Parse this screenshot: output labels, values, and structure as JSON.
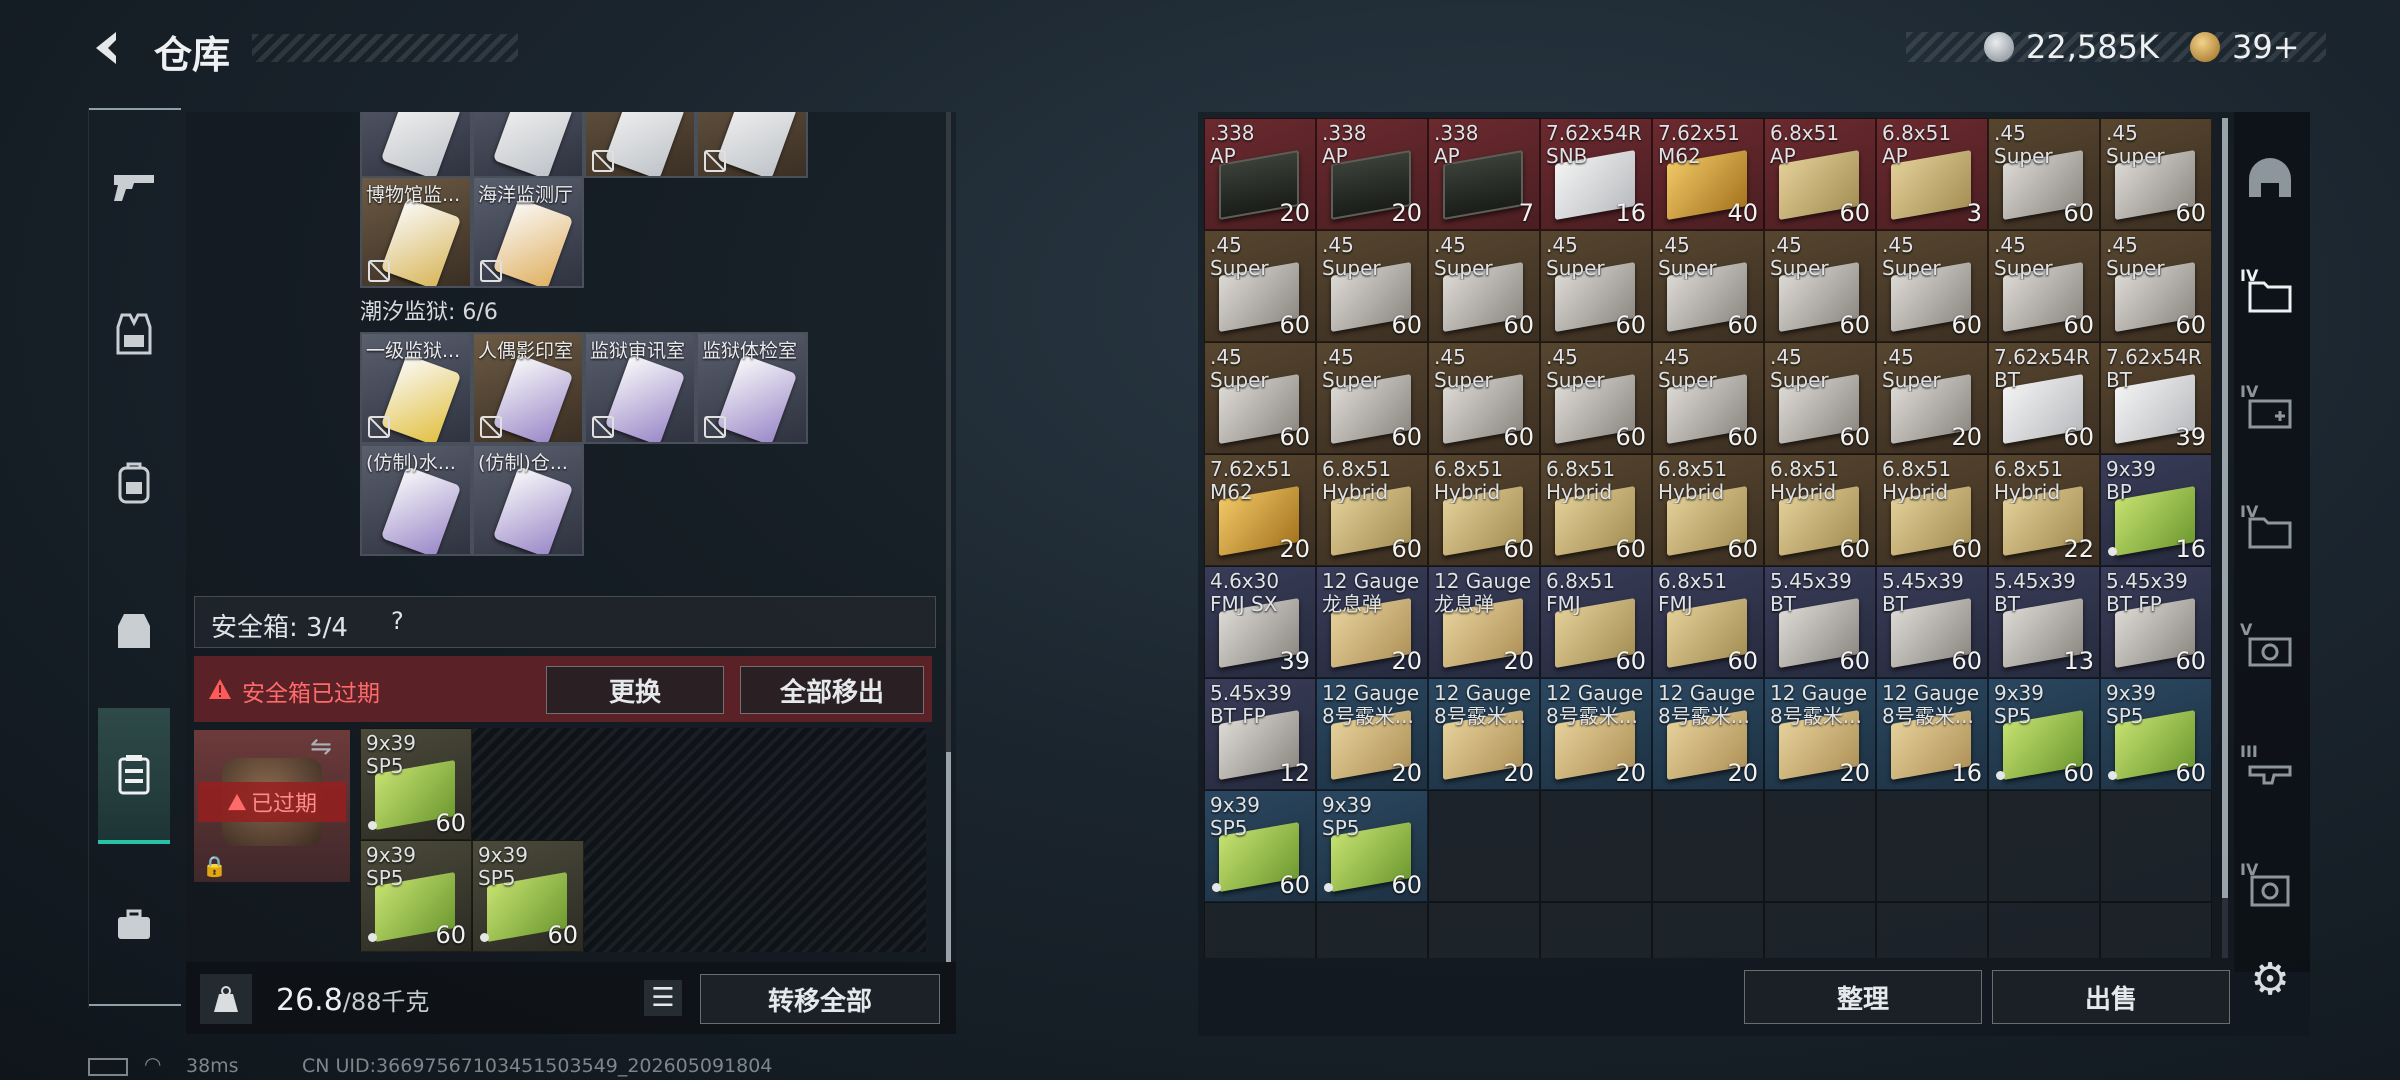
{
  "header": {
    "title": "仓库",
    "currency1": "22,585K",
    "currency2": "39+"
  },
  "left_nav": {
    "icons": [
      "pistol-icon",
      "vest-icon",
      "backpack-icon",
      "rig-icon",
      "case-icon",
      "toolbox-icon"
    ]
  },
  "keys": {
    "top_row_partial": [
      {
        "label": ""
      },
      {
        "label": ""
      },
      {
        "label": ""
      },
      {
        "label": ""
      }
    ],
    "row2": [
      {
        "label": "博物馆监..."
      },
      {
        "label": "海洋监测厅"
      }
    ],
    "section_label": "潮汐监狱: 6/6",
    "row3": [
      {
        "label": "一级监狱..."
      },
      {
        "label": "人偶影印室"
      },
      {
        "label": "监狱审讯室"
      },
      {
        "label": "监狱体检室"
      }
    ],
    "row4": [
      {
        "label": "(仿制)水..."
      },
      {
        "label": "(仿制)仓..."
      }
    ]
  },
  "safebox": {
    "label": "安全箱: 3/4",
    "help": "?",
    "expired_warning": "安全箱已过期",
    "replace_button": "更换",
    "move_all_out_button": "全部移出",
    "expired_badge": "已过期",
    "items": [
      {
        "cal": "9x39\nSP5",
        "count": "60",
        "color": "green"
      },
      {
        "cal": "9x39\nSP5",
        "count": "60",
        "color": "green"
      },
      {
        "cal": "9x39\nSP5",
        "count": "60",
        "color": "green"
      }
    ]
  },
  "footer_left": {
    "weight": "26.8",
    "weight_max": "/88千克",
    "transfer_all_button": "转移全部"
  },
  "footer_right": {
    "organize_button": "整理",
    "sell_button": "出售"
  },
  "status_bar": {
    "ping": "38ms",
    "uid": "CN UID:36697567103451503549_202605091804"
  },
  "colors": {
    "red_bg": "#5a2126",
    "brown_bg": "#4a3a2a",
    "navy_bg": "#2d3148",
    "blue_bg": "#243b4e",
    "accent": "#27c3a6"
  },
  "stash": [
    {
      "cal": ".338\nAP",
      "count": "20",
      "bg": "red",
      "art": "dark"
    },
    {
      "cal": ".338\nAP",
      "count": "20",
      "bg": "red",
      "art": "dark"
    },
    {
      "cal": ".338\nAP",
      "count": "7",
      "bg": "red",
      "art": "dark"
    },
    {
      "cal": "7.62x54R\nSNB",
      "count": "16",
      "bg": "red",
      "art": "white"
    },
    {
      "cal": "7.62x51\nM62",
      "count": "40",
      "bg": "red",
      "art": "gold"
    },
    {
      "cal": "6.8x51\nAP",
      "count": "60",
      "bg": "red",
      "art": "beige"
    },
    {
      "cal": "6.8x51\nAP",
      "count": "3",
      "bg": "red",
      "art": "beige"
    },
    {
      "cal": ".45\nSuper",
      "count": "60",
      "bg": "brown",
      "art": "grey"
    },
    {
      "cal": ".45\nSuper",
      "count": "60",
      "bg": "brown",
      "art": "grey"
    },
    {
      "cal": ".45\nSuper",
      "count": "60",
      "bg": "brown",
      "art": "grey"
    },
    {
      "cal": ".45\nSuper",
      "count": "60",
      "bg": "brown",
      "art": "grey"
    },
    {
      "cal": ".45\nSuper",
      "count": "60",
      "bg": "brown",
      "art": "grey"
    },
    {
      "cal": ".45\nSuper",
      "count": "60",
      "bg": "brown",
      "art": "grey"
    },
    {
      "cal": ".45\nSuper",
      "count": "60",
      "bg": "brown",
      "art": "grey"
    },
    {
      "cal": ".45\nSuper",
      "count": "60",
      "bg": "brown",
      "art": "grey"
    },
    {
      "cal": ".45\nSuper",
      "count": "60",
      "bg": "brown",
      "art": "grey"
    },
    {
      "cal": ".45\nSuper",
      "count": "60",
      "bg": "brown",
      "art": "grey"
    },
    {
      "cal": ".45\nSuper",
      "count": "60",
      "bg": "brown",
      "art": "grey"
    },
    {
      "cal": ".45\nSuper",
      "count": "60",
      "bg": "brown",
      "art": "grey"
    },
    {
      "cal": ".45\nSuper",
      "count": "60",
      "bg": "brown",
      "art": "grey"
    },
    {
      "cal": ".45\nSuper",
      "count": "60",
      "bg": "brown",
      "art": "grey"
    },
    {
      "cal": ".45\nSuper",
      "count": "60",
      "bg": "brown",
      "art": "grey"
    },
    {
      "cal": ".45\nSuper",
      "count": "60",
      "bg": "brown",
      "art": "grey"
    },
    {
      "cal": ".45\nSuper",
      "count": "60",
      "bg": "brown",
      "art": "grey"
    },
    {
      "cal": ".45\nSuper",
      "count": "20",
      "bg": "brown",
      "art": "grey"
    },
    {
      "cal": "7.62x54R\nBT",
      "count": "60",
      "bg": "brown",
      "art": "white"
    },
    {
      "cal": "7.62x54R\nBT",
      "count": "39",
      "bg": "brown",
      "art": "white"
    },
    {
      "cal": "7.62x51\nM62",
      "count": "20",
      "bg": "brown",
      "art": "gold"
    },
    {
      "cal": "6.8x51\nHybrid",
      "count": "60",
      "bg": "brown",
      "art": "beige"
    },
    {
      "cal": "6.8x51\nHybrid",
      "count": "60",
      "bg": "brown",
      "art": "beige"
    },
    {
      "cal": "6.8x51\nHybrid",
      "count": "60",
      "bg": "brown",
      "art": "beige"
    },
    {
      "cal": "6.8x51\nHybrid",
      "count": "60",
      "bg": "brown",
      "art": "beige"
    },
    {
      "cal": "6.8x51\nHybrid",
      "count": "60",
      "bg": "brown",
      "art": "beige"
    },
    {
      "cal": "6.8x51\nHybrid",
      "count": "60",
      "bg": "brown",
      "art": "beige"
    },
    {
      "cal": "6.8x51\nHybrid",
      "count": "22",
      "bg": "brown",
      "art": "beige"
    },
    {
      "cal": "9x39\nBP",
      "count": "16",
      "bg": "navy",
      "art": "green",
      "dot": true
    },
    {
      "cal": "4.6x30\nFMJ SX",
      "count": "39",
      "bg": "navy",
      "art": "grey"
    },
    {
      "cal": "12 Gauge\n龙息弹",
      "count": "20",
      "bg": "navy",
      "art": "tan"
    },
    {
      "cal": "12 Gauge\n龙息弹",
      "count": "20",
      "bg": "navy",
      "art": "tan"
    },
    {
      "cal": "6.8x51\nFMJ",
      "count": "60",
      "bg": "navy",
      "art": "beige"
    },
    {
      "cal": "6.8x51\nFMJ",
      "count": "60",
      "bg": "navy",
      "art": "beige"
    },
    {
      "cal": "5.45x39\nBT",
      "count": "60",
      "bg": "navy",
      "art": "grey"
    },
    {
      "cal": "5.45x39\nBT",
      "count": "60",
      "bg": "navy",
      "art": "grey"
    },
    {
      "cal": "5.45x39\nBT",
      "count": "13",
      "bg": "navy",
      "art": "grey"
    },
    {
      "cal": "5.45x39\nBT FP",
      "count": "60",
      "bg": "navy",
      "art": "grey"
    },
    {
      "cal": "5.45x39\nBT FP",
      "count": "12",
      "bg": "navy",
      "art": "grey"
    },
    {
      "cal": "12 Gauge\n8号霰米...",
      "count": "20",
      "bg": "blue",
      "art": "tan"
    },
    {
      "cal": "12 Gauge\n8号霰米...",
      "count": "20",
      "bg": "blue",
      "art": "tan"
    },
    {
      "cal": "12 Gauge\n8号霰米...",
      "count": "20",
      "bg": "blue",
      "art": "tan"
    },
    {
      "cal": "12 Gauge\n8号霰米...",
      "count": "20",
      "bg": "blue",
      "art": "tan"
    },
    {
      "cal": "12 Gauge\n8号霰米...",
      "count": "20",
      "bg": "blue",
      "art": "tan"
    },
    {
      "cal": "12 Gauge\n8号霰米...",
      "count": "16",
      "bg": "blue",
      "art": "tan"
    },
    {
      "cal": "9x39\nSP5",
      "count": "60",
      "bg": "blue",
      "art": "green",
      "dot": true
    },
    {
      "cal": "9x39\nSP5",
      "count": "60",
      "bg": "blue",
      "art": "green",
      "dot": true
    },
    {
      "cal": "9x39\nSP5",
      "count": "60",
      "bg": "blue",
      "art": "green",
      "dot": true
    },
    {
      "cal": "9x39\nSP5",
      "count": "60",
      "bg": "blue",
      "art": "green",
      "dot": true
    }
  ],
  "right_nav": {
    "icons": [
      "helmet-icon",
      "folder-iv-icon",
      "medkit-iv-icon",
      "folder-iv-2-icon",
      "gear-v-icon",
      "rifle-iii-icon",
      "case-iv-icon",
      "settings-icon"
    ],
    "tiers": [
      "IV",
      "IV",
      "IV",
      "V",
      "III",
      "IV"
    ]
  }
}
